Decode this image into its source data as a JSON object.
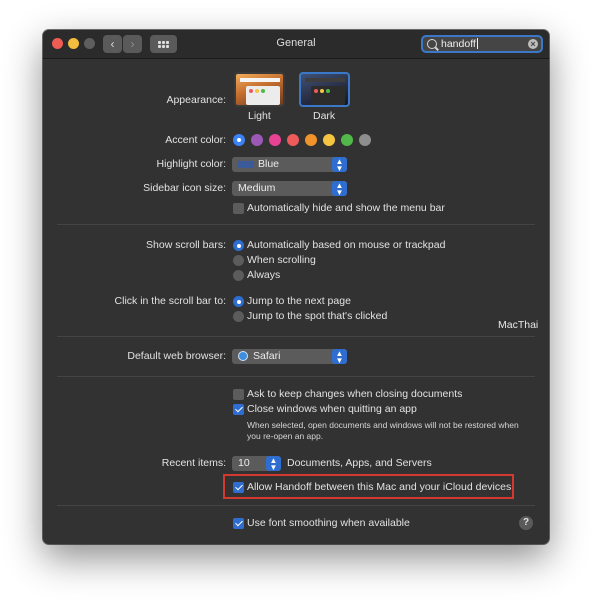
{
  "window": {
    "title": "General"
  },
  "search": {
    "value": "handoff"
  },
  "appearance": {
    "label": "Appearance:",
    "options": [
      {
        "label": "Light"
      },
      {
        "label": "Dark"
      }
    ],
    "selected": "Dark"
  },
  "accent": {
    "label": "Accent color:",
    "colors": [
      "#3b82f6",
      "#9b59b6",
      "#e84393",
      "#ef5a5a",
      "#f0932b",
      "#f5c542",
      "#52b84a",
      "#8e8e8e"
    ],
    "selected_index": 0
  },
  "highlight": {
    "label": "Highlight color:",
    "value": "Blue",
    "swatch": "#3b5a9a"
  },
  "sidebar_icon_size": {
    "label": "Sidebar icon size:",
    "value": "Medium"
  },
  "menu_bar": {
    "auto_hide_label": "Automatically hide and show the menu bar",
    "checked": false
  },
  "scroll_bars": {
    "label": "Show scroll bars:",
    "options": [
      "Automatically based on mouse or trackpad",
      "When scrolling",
      "Always"
    ],
    "selected_index": 0
  },
  "scroll_click": {
    "label": "Click in the scroll bar to:",
    "options": [
      "Jump to the next page",
      "Jump to the spot that's clicked"
    ],
    "selected_index": 0
  },
  "watermark": "MacThai",
  "web_browser": {
    "label": "Default web browser:",
    "value": "Safari"
  },
  "ask_keep_changes": {
    "label": "Ask to keep changes when closing documents",
    "checked": false
  },
  "close_windows": {
    "label": "Close windows when quitting an app",
    "checked": true,
    "note": "When selected, open documents and windows will not be restored when you re-open an app."
  },
  "recent_items": {
    "label": "Recent items:",
    "value": "10",
    "suffix": "Documents, Apps, and Servers"
  },
  "handoff": {
    "label": "Allow Handoff between this Mac and your iCloud devices",
    "checked": true
  },
  "font_smoothing": {
    "label": "Use font smoothing when available",
    "checked": true
  },
  "help": {
    "glyph": "?"
  }
}
